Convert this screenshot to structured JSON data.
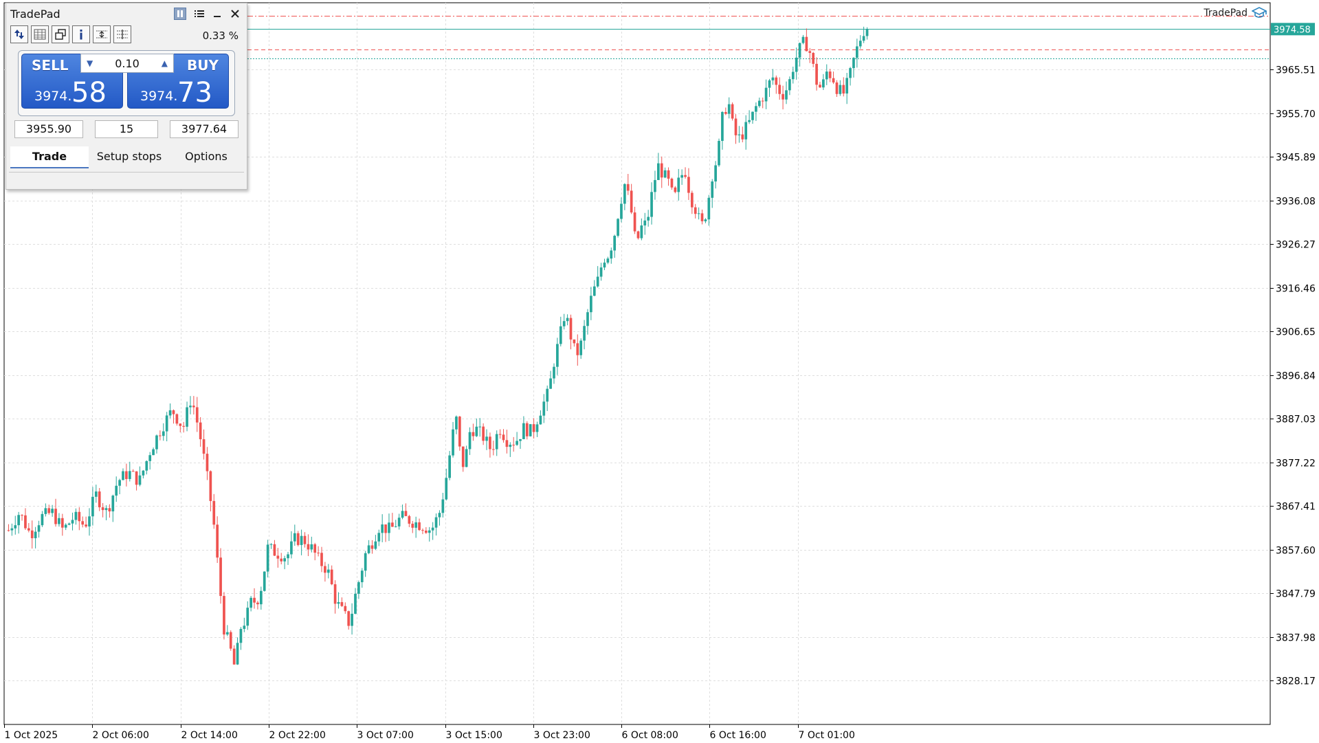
{
  "colors": {
    "bull": "#26a69a",
    "bear": "#ef5350",
    "grid": "#dedede",
    "axis": "#000000",
    "last_price_bg": "#26a69a",
    "buy_sell_blue": "#2f64d0",
    "sl_line": "#ef5350",
    "tp_line": "#26a69a"
  },
  "brand": {
    "label": "TradePad",
    "icon": "graduation-cap-icon"
  },
  "tradepad": {
    "title": "TradePad",
    "title_buttons": {
      "pause": "pause-icon",
      "menu": "list-icon",
      "minimize": "minimize-icon",
      "close": "close-icon"
    },
    "toolbar_icons": [
      "order-direction-icon",
      "grid-icon",
      "windows-icon",
      "info-icon",
      "range-icon",
      "levels-icon"
    ],
    "risk_percent": "0.33 %",
    "sell_label": "SELL",
    "buy_label": "BUY",
    "volume": "0.10",
    "sell_price_small": "3974.",
    "sell_price_big": "58",
    "buy_price_small": "3974.",
    "buy_price_big": "73",
    "stop_loss": "3955.90",
    "points": "15",
    "take_profit": "3977.64",
    "tabs": [
      "Trade",
      "Setup stops",
      "Options"
    ],
    "active_tab": "Trade"
  },
  "chart_data": {
    "type": "candlestick",
    "title": "",
    "xlabel": "",
    "ylabel": "",
    "ylim": [
      3818.36,
      3980.5
    ],
    "grid": true,
    "y_ticks": [
      3965.51,
      3955.7,
      3945.89,
      3936.08,
      3926.27,
      3916.46,
      3906.65,
      3896.84,
      3887.03,
      3877.22,
      3867.41,
      3857.6,
      3847.79,
      3837.98,
      3828.17
    ],
    "x_ticks": [
      "1 Oct 2025",
      "2 Oct 06:00",
      "2 Oct 14:00",
      "2 Oct 22:00",
      "3 Oct 07:00",
      "3 Oct 15:00",
      "3 Oct 23:00",
      "6 Oct 08:00",
      "6 Oct 16:00",
      "7 Oct 01:00"
    ],
    "last_price": "3974.58",
    "last_price_value": 3974.58,
    "horizontal_lines": [
      {
        "name": "ask-line",
        "value": 3977.64,
        "style": "dash-dot"
      },
      {
        "name": "bid-line",
        "value": 3974.58,
        "style": "solid"
      },
      {
        "name": "stop-line",
        "value": 3970.0,
        "style": "dashed"
      },
      {
        "name": "target-line",
        "value": 3968.0,
        "style": "dotted"
      }
    ],
    "candles_count": 256,
    "close_path": [
      [
        0,
        3862
      ],
      [
        8,
        3866
      ],
      [
        16,
        3861
      ],
      [
        24,
        3865
      ],
      [
        32,
        3866
      ],
      [
        40,
        3862
      ],
      [
        48,
        3865
      ],
      [
        56,
        3863
      ],
      [
        64,
        3870
      ],
      [
        72,
        3866
      ],
      [
        80,
        3873
      ],
      [
        88,
        3875
      ],
      [
        96,
        3873
      ],
      [
        104,
        3880
      ],
      [
        112,
        3885
      ],
      [
        120,
        3889
      ],
      [
        128,
        3885
      ],
      [
        134,
        3892
      ],
      [
        140,
        3884
      ],
      [
        145,
        3875
      ],
      [
        150,
        3865
      ],
      [
        154,
        3852
      ],
      [
        158,
        3840
      ],
      [
        162,
        3836
      ],
      [
        166,
        3831
      ],
      [
        170,
        3840
      ],
      [
        174,
        3842
      ],
      [
        178,
        3846
      ],
      [
        182,
        3846
      ],
      [
        186,
        3850
      ],
      [
        190,
        3858
      ],
      [
        196,
        3857
      ],
      [
        204,
        3856
      ],
      [
        210,
        3860
      ],
      [
        216,
        3860
      ],
      [
        222,
        3858
      ],
      [
        228,
        3855
      ],
      [
        234,
        3853
      ],
      [
        240,
        3846
      ],
      [
        246,
        3843
      ],
      [
        250,
        3841
      ],
      [
        254,
        3847
      ],
      [
        258,
        3852
      ],
      [
        262,
        3857
      ],
      [
        266,
        3859
      ],
      [
        272,
        3863
      ],
      [
        280,
        3862
      ],
      [
        288,
        3865
      ],
      [
        296,
        3864
      ],
      [
        304,
        3863
      ],
      [
        310,
        3862
      ],
      [
        316,
        3866
      ],
      [
        320,
        3872
      ],
      [
        324,
        3880
      ],
      [
        328,
        3888
      ],
      [
        330,
        3881
      ],
      [
        334,
        3876
      ],
      [
        338,
        3884
      ],
      [
        342,
        3885
      ],
      [
        348,
        3883
      ],
      [
        354,
        3880
      ],
      [
        360,
        3885
      ],
      [
        366,
        3882
      ],
      [
        372,
        3882
      ],
      [
        378,
        3885
      ],
      [
        384,
        3884
      ],
      [
        390,
        3889
      ],
      [
        396,
        3893
      ],
      [
        400,
        3900
      ],
      [
        404,
        3905
      ],
      [
        408,
        3911
      ],
      [
        412,
        3906
      ],
      [
        416,
        3901
      ],
      [
        420,
        3904
      ],
      [
        424,
        3910
      ],
      [
        428,
        3915
      ],
      [
        432,
        3918
      ],
      [
        436,
        3923
      ],
      [
        440,
        3924
      ],
      [
        444,
        3928
      ],
      [
        448,
        3935
      ],
      [
        452,
        3940
      ],
      [
        456,
        3935
      ],
      [
        460,
        3926
      ],
      [
        464,
        3930
      ],
      [
        468,
        3931
      ],
      [
        472,
        3938
      ],
      [
        476,
        3944
      ],
      [
        480,
        3942
      ],
      [
        484,
        3940
      ],
      [
        488,
        3936
      ],
      [
        492,
        3941
      ],
      [
        496,
        3943
      ],
      [
        500,
        3937
      ],
      [
        504,
        3934
      ],
      [
        508,
        3930
      ],
      [
        512,
        3934
      ],
      [
        516,
        3942
      ],
      [
        520,
        3946
      ],
      [
        524,
        3956
      ],
      [
        528,
        3958
      ],
      [
        532,
        3951
      ],
      [
        536,
        3950
      ],
      [
        540,
        3952
      ],
      [
        544,
        3954
      ],
      [
        548,
        3957
      ],
      [
        552,
        3959
      ],
      [
        556,
        3961
      ],
      [
        560,
        3964
      ],
      [
        564,
        3961
      ],
      [
        568,
        3960
      ],
      [
        572,
        3962
      ],
      [
        576,
        3967
      ],
      [
        580,
        3970
      ],
      [
        584,
        3972
      ],
      [
        588,
        3969
      ],
      [
        592,
        3963
      ],
      [
        596,
        3961
      ],
      [
        600,
        3965
      ],
      [
        604,
        3964
      ],
      [
        608,
        3961
      ],
      [
        612,
        3960
      ],
      [
        616,
        3963
      ],
      [
        620,
        3968
      ],
      [
        624,
        3972
      ],
      [
        628,
        3975
      ],
      [
        632,
        3975
      ]
    ]
  }
}
